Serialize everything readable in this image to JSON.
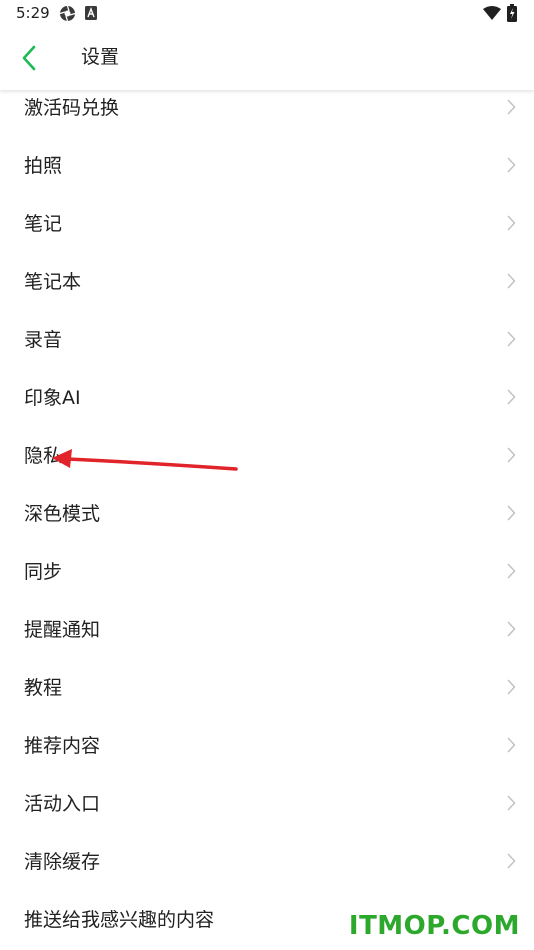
{
  "status_bar": {
    "time": "5:29"
  },
  "header": {
    "title": "设置",
    "accent_color": "#1db954"
  },
  "settings": {
    "items": [
      {
        "label": "激活码兑换"
      },
      {
        "label": "拍照"
      },
      {
        "label": "笔记"
      },
      {
        "label": "笔记本"
      },
      {
        "label": "录音"
      },
      {
        "label": "印象AI"
      },
      {
        "label": "隐私"
      },
      {
        "label": "深色模式"
      },
      {
        "label": "同步"
      },
      {
        "label": "提醒通知"
      },
      {
        "label": "教程"
      },
      {
        "label": "推荐内容"
      },
      {
        "label": "活动入口"
      },
      {
        "label": "清除缓存"
      },
      {
        "label": "推送给我感兴趣的内容"
      }
    ]
  },
  "annotation": {
    "color": "#e0242a",
    "target": "隐私"
  },
  "watermark": {
    "text": "ITMOP.COM",
    "color": "#2ca82c"
  }
}
